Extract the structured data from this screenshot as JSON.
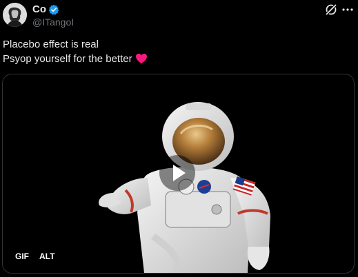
{
  "author": {
    "display_name": "Co",
    "handle": "@ITangoI",
    "verified": true,
    "verified_color": "#1d9bf0"
  },
  "header_icons": [
    "grok-icon",
    "more-icon"
  ],
  "post": {
    "lines": [
      "Placebo effect is real",
      "Psyop yourself for the better"
    ],
    "emoji": "heart-icon",
    "emoji_color": "#f91880"
  },
  "media": {
    "type": "gif",
    "gif_badge": "GIF",
    "alt_badge": "ALT",
    "play_icon": "play-icon",
    "description_icon": "astronaut-icon"
  }
}
